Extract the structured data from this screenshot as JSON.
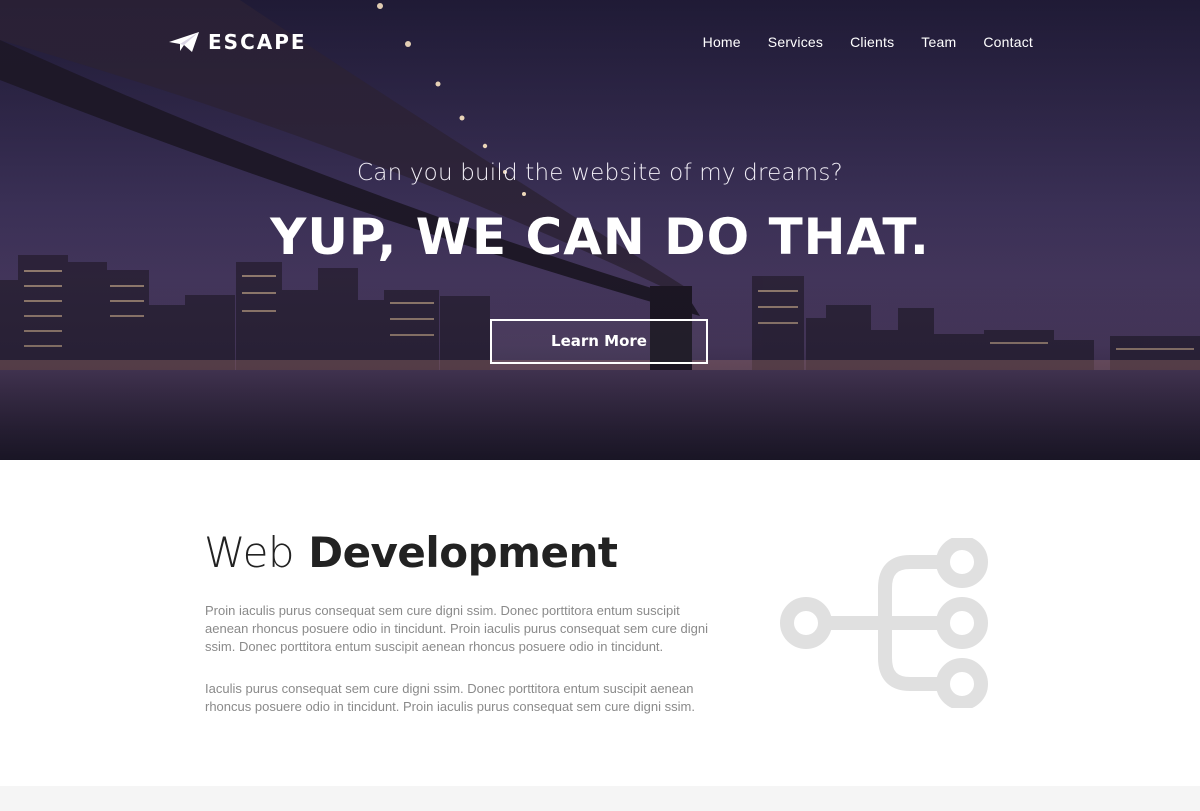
{
  "brand": {
    "name": "ESCAPE",
    "icon": "paper-plane-icon"
  },
  "nav": {
    "items": [
      "Home",
      "Services",
      "Clients",
      "Team",
      "Contact"
    ]
  },
  "hero": {
    "subtitle": "Can you build the website of my dreams?",
    "headline": "YUP, WE CAN DO THAT.",
    "cta_label": "Learn More"
  },
  "section": {
    "title_light": "Web",
    "title_bold": "Development",
    "paragraphs": [
      "Proin iaculis purus consequat sem cure digni ssim. Donec porttitora entum suscipit aenean rhoncus posuere odio in tincidunt. Proin iaculis purus consequat sem cure digni ssim. Donec porttitora entum suscipit aenean rhoncus posuere odio in tincidunt.",
      "Iaculis purus consequat sem cure digni ssim. Donec porttitora entum suscipit aenean rhoncus posuere odio in tincidunt. Proin iaculis purus consequat sem cure digni ssim."
    ],
    "icon": "sitemap-tree-icon"
  },
  "colors": {
    "icon_gray": "#e0e0e0",
    "text_dark": "#222222",
    "text_muted": "#8a8a8a"
  }
}
